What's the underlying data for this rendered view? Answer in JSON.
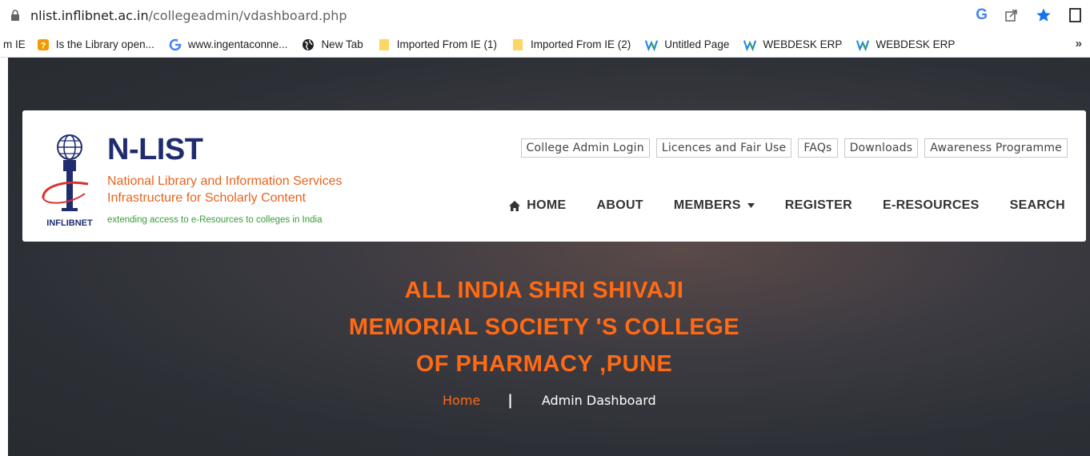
{
  "browser": {
    "url_host": "nlist.inflibnet.ac.in",
    "url_path": "/collegeadmin/vdashboard.php",
    "g_icon": "G"
  },
  "bookmarks": {
    "items": [
      {
        "label": "m IE",
        "icon": "none"
      },
      {
        "label": "Is the Library open...",
        "icon": "question-icon"
      },
      {
        "label": "www.ingentaconne...",
        "icon": "google-icon"
      },
      {
        "label": "New Tab",
        "icon": "globe-icon"
      },
      {
        "label": "Imported From IE (1)",
        "icon": "folder-icon"
      },
      {
        "label": "Imported From IE (2)",
        "icon": "folder-icon"
      },
      {
        "label": "Untitled Page",
        "icon": "w-icon"
      },
      {
        "label": "WEBDESK ERP",
        "icon": "w-icon"
      },
      {
        "label": "WEBDESK ERP",
        "icon": "w-icon"
      }
    ],
    "more": "»"
  },
  "brand": {
    "title": "N-LIST",
    "subtitle1": "National Library and Information Services",
    "subtitle2": "Infrastructure for Scholarly Content",
    "tagline": "extending access to e-Resources to colleges in India",
    "emblem_text": "INFLIBNET"
  },
  "toplinks": [
    "College Admin Login",
    "Licences and Fair Use",
    "FAQs",
    "Downloads",
    "Awareness Programme"
  ],
  "nav": {
    "home": "HOME",
    "about": "ABOUT",
    "members": "MEMBERS",
    "register": "REGISTER",
    "eresources": "E-RESOURCES",
    "search": "SEARCH"
  },
  "hero": {
    "line1": "ALL INDIA SHRI SHIVAJI",
    "line2": "MEMORIAL SOCIETY 'S COLLEGE",
    "line3": "OF PHARMACY ,PUNE",
    "crumb_home": "Home",
    "crumb_sep": "|",
    "crumb_current": "Admin Dashboard"
  },
  "colors": {
    "accent_orange": "#ff6a14",
    "brand_navy": "#1f2d6e",
    "tagline_green": "#3a9a3a"
  }
}
